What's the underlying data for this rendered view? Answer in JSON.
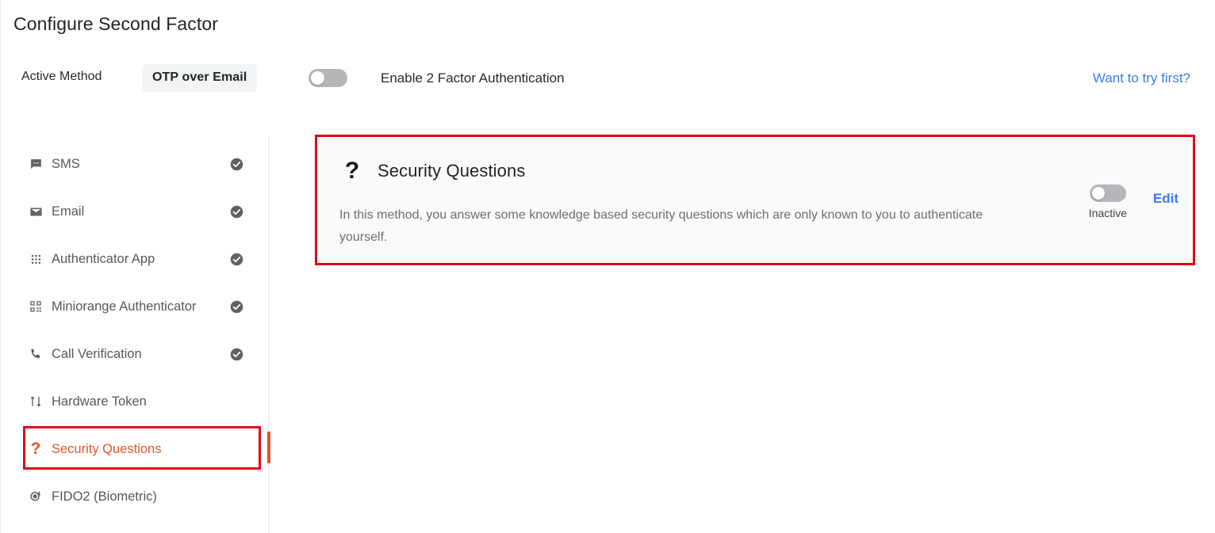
{
  "header": {
    "title": "Configure Second Factor"
  },
  "control_bar": {
    "active_method_label": "Active Method",
    "active_method_value": "OTP over Email",
    "enable_toggle": {
      "name": "enable-2fa-toggle",
      "label": "Enable 2 Factor Authentication",
      "state": "off"
    },
    "try_first_link": "Want to try first?"
  },
  "sidebar": {
    "items": [
      {
        "label": "SMS",
        "icon": "sms-chat-icon",
        "configured": true,
        "active": false
      },
      {
        "label": "Email",
        "icon": "envelope-icon",
        "configured": true,
        "active": false
      },
      {
        "label": "Authenticator App",
        "icon": "dot-grid-icon",
        "configured": true,
        "active": false
      },
      {
        "label": "Miniorange Authenticator",
        "icon": "qr-code-icon",
        "configured": true,
        "active": false
      },
      {
        "label": "Call Verification",
        "icon": "phone-icon",
        "configured": true,
        "active": false
      },
      {
        "label": "Hardware Token",
        "icon": "sliders-icon",
        "configured": false,
        "active": false
      },
      {
        "label": "Security Questions",
        "icon": "question-mark-icon",
        "configured": false,
        "active": true
      },
      {
        "label": "FIDO2 (Biometric)",
        "icon": "fingerprint-key-icon",
        "configured": false,
        "active": false
      }
    ]
  },
  "card": {
    "icon": "question-mark-icon",
    "title": "Security Questions",
    "description": "In this method, you answer some knowledge based security questions which are only known to you to authenticate yourself.",
    "toggle": {
      "name": "security-questions-toggle",
      "state_label": "Inactive",
      "state": "off"
    },
    "edit_label": "Edit"
  },
  "colors": {
    "accent_orange": "#e4552b",
    "link_blue": "#3b7af0",
    "annotation_red": "#e30613",
    "card_background": "#fafafa",
    "toggle_off": "#b4b6ba",
    "check_grey": "#5e6166"
  }
}
